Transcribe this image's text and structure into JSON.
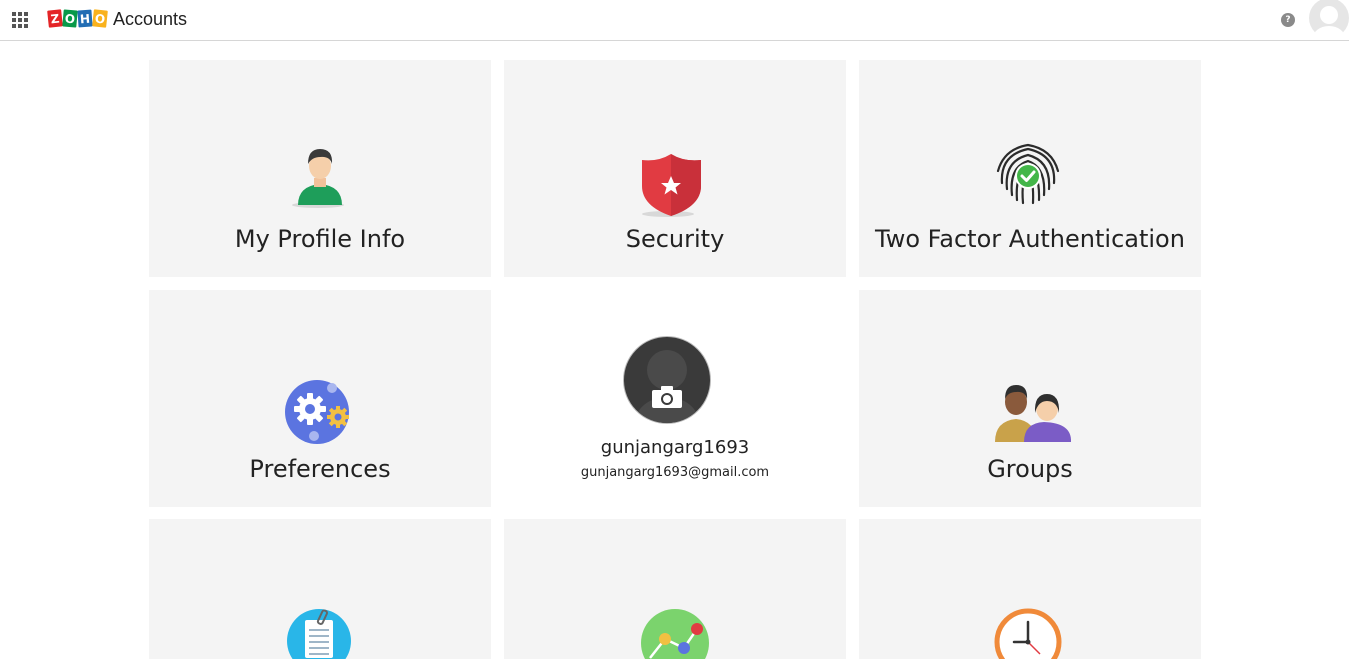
{
  "header": {
    "logo_letters": [
      "Z",
      "O",
      "H",
      "O"
    ],
    "logo_colors": [
      "#e42527",
      "#089949",
      "#226db4",
      "#f9b21d"
    ],
    "app_title": "Accounts",
    "help_glyph": "?"
  },
  "tiles": [
    {
      "label": "My Profile Info",
      "icon": "user-icon"
    },
    {
      "label": "Security",
      "icon": "shield-icon"
    },
    {
      "label": "Two Factor Authentication",
      "icon": "fingerprint-icon"
    },
    {
      "label": "Preferences",
      "icon": "gears-icon"
    },
    {
      "label": "Groups",
      "icon": "group-icon"
    },
    {
      "label": "",
      "icon": "clipboard-icon"
    },
    {
      "label": "",
      "icon": "graph-icon"
    },
    {
      "label": "",
      "icon": "clock-icon"
    }
  ],
  "profile": {
    "username": "gunjangarg1693",
    "email": "gunjangarg1693@gmail.com"
  }
}
